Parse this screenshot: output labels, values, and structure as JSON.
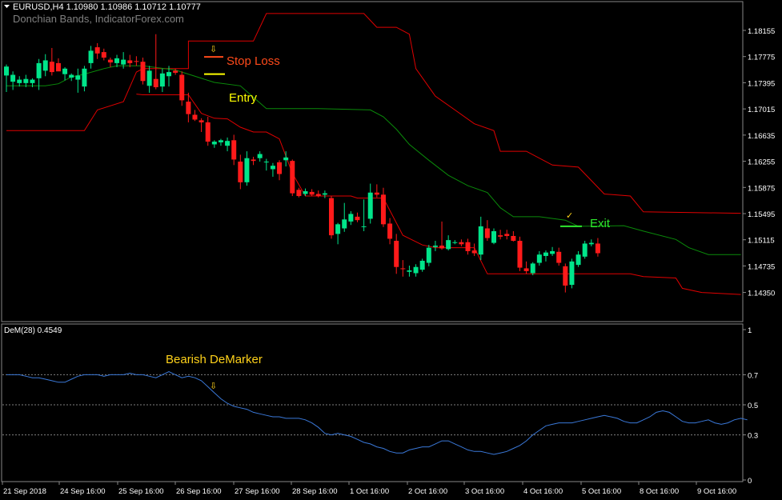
{
  "header": {
    "symbol_line": "EURUSD,H4  1.10980 1.10986 1.10712 1.10777",
    "indicator_name": "Donchian Bands, IndicatorForex.com"
  },
  "annotations": {
    "stop_loss": "Stop Loss",
    "entry": "Entry",
    "exit": "Exit",
    "bearish_demarker": "Bearish DeMarker",
    "down_arrow": "⇩",
    "check": "✓"
  },
  "subwindow": {
    "label": "DeM(28) 0.4549"
  },
  "colors": {
    "background": "#000000",
    "bull": "#00e58a",
    "bear": "#ff1a1a",
    "upper_band": "#e00000",
    "lower_band": "#e00000",
    "middle_band": "#0a8a0a",
    "demarker_line": "#3a78d8",
    "stop_loss": "#ff4a1a",
    "entry": "#ffff00",
    "exit": "#2ee82e",
    "bearish_text": "#ffd21a",
    "arrow": "#ffd21a",
    "grid": "#808080",
    "axis_text": "#ffffff"
  },
  "chart_data": [
    {
      "type": "candlestick",
      "title": "EURUSD,H4",
      "ylim": [
        1.1395,
        1.1855
      ],
      "price_labels": [
        "1.18155",
        "1.17775",
        "1.17395",
        "1.17015",
        "1.16635",
        "1.16255",
        "1.15875",
        "1.15495",
        "1.15115",
        "1.14735",
        "1.14350"
      ],
      "x_labels": [
        "21 Sep 2018",
        "24 Sep 16:00",
        "25 Sep 16:00",
        "26 Sep 16:00",
        "27 Sep 16:00",
        "28 Sep 16:00",
        "1 Oct 16:00",
        "2 Oct 16:00",
        "3 Oct 16:00",
        "4 Oct 16:00",
        "5 Oct 16:00",
        "8 Oct 16:00",
        "9 Oct 16:00"
      ],
      "candles": [
        {
          "o": 1.175,
          "h": 1.1766,
          "l": 1.1726,
          "c": 1.1763
        },
        {
          "o": 1.1741,
          "h": 1.1756,
          "l": 1.1729,
          "c": 1.1751
        },
        {
          "o": 1.1739,
          "h": 1.1749,
          "l": 1.1734,
          "c": 1.1744
        },
        {
          "o": 1.1739,
          "h": 1.1751,
          "l": 1.1733,
          "c": 1.1745
        },
        {
          "o": 1.1739,
          "h": 1.1746,
          "l": 1.1733,
          "c": 1.1744
        },
        {
          "o": 1.1746,
          "h": 1.1774,
          "l": 1.1729,
          "c": 1.1768
        },
        {
          "o": 1.1757,
          "h": 1.1781,
          "l": 1.1749,
          "c": 1.1772
        },
        {
          "o": 1.177,
          "h": 1.179,
          "l": 1.175,
          "c": 1.1755
        },
        {
          "o": 1.1768,
          "h": 1.1775,
          "l": 1.1758,
          "c": 1.1756
        },
        {
          "o": 1.1752,
          "h": 1.1762,
          "l": 1.1743,
          "c": 1.176
        },
        {
          "o": 1.1747,
          "h": 1.1753,
          "l": 1.1742,
          "c": 1.1751
        },
        {
          "o": 1.1744,
          "h": 1.176,
          "l": 1.1725,
          "c": 1.175
        },
        {
          "o": 1.1734,
          "h": 1.1764,
          "l": 1.1727,
          "c": 1.176
        },
        {
          "o": 1.1768,
          "h": 1.1793,
          "l": 1.176,
          "c": 1.1786
        },
        {
          "o": 1.1791,
          "h": 1.1797,
          "l": 1.1774,
          "c": 1.1782
        },
        {
          "o": 1.1784,
          "h": 1.1789,
          "l": 1.1772,
          "c": 1.1776
        },
        {
          "o": 1.1773,
          "h": 1.1776,
          "l": 1.1762,
          "c": 1.1769
        },
        {
          "o": 1.1768,
          "h": 1.178,
          "l": 1.1762,
          "c": 1.1775
        },
        {
          "o": 1.1766,
          "h": 1.1784,
          "l": 1.176,
          "c": 1.1773
        },
        {
          "o": 1.1772,
          "h": 1.178,
          "l": 1.1762,
          "c": 1.1768
        },
        {
          "o": 1.1771,
          "h": 1.1778,
          "l": 1.1764,
          "c": 1.177
        },
        {
          "o": 1.177,
          "h": 1.1776,
          "l": 1.1737,
          "c": 1.1742
        },
        {
          "o": 1.1735,
          "h": 1.1764,
          "l": 1.1725,
          "c": 1.1757
        },
        {
          "o": 1.1745,
          "h": 1.181,
          "l": 1.173,
          "c": 1.1733
        },
        {
          "o": 1.1734,
          "h": 1.176,
          "l": 1.1726,
          "c": 1.1753
        },
        {
          "o": 1.1749,
          "h": 1.1764,
          "l": 1.1734,
          "c": 1.1755
        },
        {
          "o": 1.1757,
          "h": 1.176,
          "l": 1.1751,
          "c": 1.1754
        },
        {
          "o": 1.1751,
          "h": 1.1756,
          "l": 1.1706,
          "c": 1.1714
        },
        {
          "o": 1.1712,
          "h": 1.1725,
          "l": 1.1682,
          "c": 1.1694
        },
        {
          "o": 1.1693,
          "h": 1.17,
          "l": 1.1684,
          "c": 1.1686
        },
        {
          "o": 1.1685,
          "h": 1.1688,
          "l": 1.1668,
          "c": 1.1682
        },
        {
          "o": 1.1682,
          "h": 1.169,
          "l": 1.1648,
          "c": 1.1654
        },
        {
          "o": 1.165,
          "h": 1.1656,
          "l": 1.1645,
          "c": 1.1654
        },
        {
          "o": 1.1653,
          "h": 1.1658,
          "l": 1.1648,
          "c": 1.1656
        },
        {
          "o": 1.1648,
          "h": 1.166,
          "l": 1.164,
          "c": 1.1655
        },
        {
          "o": 1.1656,
          "h": 1.1664,
          "l": 1.162,
          "c": 1.1628
        },
        {
          "o": 1.1625,
          "h": 1.1635,
          "l": 1.1585,
          "c": 1.1595
        },
        {
          "o": 1.1595,
          "h": 1.164,
          "l": 1.159,
          "c": 1.163
        },
        {
          "o": 1.1628,
          "h": 1.1632,
          "l": 1.162,
          "c": 1.1626
        },
        {
          "o": 1.163,
          "h": 1.164,
          "l": 1.1625,
          "c": 1.1636
        },
        {
          "o": 1.1624,
          "h": 1.1629,
          "l": 1.1612,
          "c": 1.1625
        },
        {
          "o": 1.1614,
          "h": 1.1623,
          "l": 1.1603,
          "c": 1.1619
        },
        {
          "o": 1.1624,
          "h": 1.1627,
          "l": 1.1598,
          "c": 1.1607
        },
        {
          "o": 1.1627,
          "h": 1.164,
          "l": 1.1618,
          "c": 1.1631
        },
        {
          "o": 1.1626,
          "h": 1.1628,
          "l": 1.1575,
          "c": 1.1579
        },
        {
          "o": 1.1584,
          "h": 1.1587,
          "l": 1.1573,
          "c": 1.1575
        },
        {
          "o": 1.1578,
          "h": 1.1586,
          "l": 1.1575,
          "c": 1.1582
        },
        {
          "o": 1.1581,
          "h": 1.1585,
          "l": 1.1575,
          "c": 1.1577
        },
        {
          "o": 1.1578,
          "h": 1.1583,
          "l": 1.1573,
          "c": 1.1575
        },
        {
          "o": 1.1577,
          "h": 1.1583,
          "l": 1.1572,
          "c": 1.1579
        },
        {
          "o": 1.1572,
          "h": 1.1575,
          "l": 1.1513,
          "c": 1.1518
        },
        {
          "o": 1.152,
          "h": 1.1536,
          "l": 1.1505,
          "c": 1.1534
        },
        {
          "o": 1.1528,
          "h": 1.1565,
          "l": 1.1523,
          "c": 1.1541
        },
        {
          "o": 1.1538,
          "h": 1.1553,
          "l": 1.1533,
          "c": 1.1549
        },
        {
          "o": 1.1545,
          "h": 1.1551,
          "l": 1.1537,
          "c": 1.154
        },
        {
          "o": 1.153,
          "h": 1.157,
          "l": 1.1524,
          "c": 1.1531
        },
        {
          "o": 1.1542,
          "h": 1.1593,
          "l": 1.1535,
          "c": 1.158
        },
        {
          "o": 1.158,
          "h": 1.1592,
          "l": 1.1573,
          "c": 1.1577
        },
        {
          "o": 1.1577,
          "h": 1.1587,
          "l": 1.153,
          "c": 1.1534
        },
        {
          "o": 1.1535,
          "h": 1.1543,
          "l": 1.1505,
          "c": 1.1513
        },
        {
          "o": 1.151,
          "h": 1.152,
          "l": 1.1462,
          "c": 1.1472
        },
        {
          "o": 1.147,
          "h": 1.1482,
          "l": 1.1458,
          "c": 1.1469
        },
        {
          "o": 1.1465,
          "h": 1.1474,
          "l": 1.1458,
          "c": 1.1467
        },
        {
          "o": 1.1463,
          "h": 1.1476,
          "l": 1.1458,
          "c": 1.1472
        },
        {
          "o": 1.1468,
          "h": 1.1484,
          "l": 1.1465,
          "c": 1.1481
        },
        {
          "o": 1.1478,
          "h": 1.1504,
          "l": 1.1473,
          "c": 1.15
        },
        {
          "o": 1.1501,
          "h": 1.151,
          "l": 1.1495,
          "c": 1.1503
        },
        {
          "o": 1.1503,
          "h": 1.1538,
          "l": 1.1497,
          "c": 1.1499
        },
        {
          "o": 1.1498,
          "h": 1.1518,
          "l": 1.1496,
          "c": 1.1511
        },
        {
          "o": 1.1507,
          "h": 1.1511,
          "l": 1.1505,
          "c": 1.1508
        },
        {
          "o": 1.1508,
          "h": 1.1512,
          "l": 1.1502,
          "c": 1.1505
        },
        {
          "o": 1.1508,
          "h": 1.1513,
          "l": 1.149,
          "c": 1.1495
        },
        {
          "o": 1.1496,
          "h": 1.1506,
          "l": 1.1488,
          "c": 1.1492
        },
        {
          "o": 1.149,
          "h": 1.1545,
          "l": 1.1482,
          "c": 1.1531
        },
        {
          "o": 1.1528,
          "h": 1.154,
          "l": 1.151,
          "c": 1.1514
        },
        {
          "o": 1.1507,
          "h": 1.1528,
          "l": 1.1505,
          "c": 1.1524
        },
        {
          "o": 1.1518,
          "h": 1.1526,
          "l": 1.1512,
          "c": 1.1516
        },
        {
          "o": 1.152,
          "h": 1.1526,
          "l": 1.1512,
          "c": 1.1517
        },
        {
          "o": 1.1517,
          "h": 1.1524,
          "l": 1.1509,
          "c": 1.151
        },
        {
          "o": 1.151,
          "h": 1.1516,
          "l": 1.1466,
          "c": 1.1471
        },
        {
          "o": 1.147,
          "h": 1.148,
          "l": 1.1462,
          "c": 1.1466
        },
        {
          "o": 1.1463,
          "h": 1.1479,
          "l": 1.146,
          "c": 1.1477
        },
        {
          "o": 1.1478,
          "h": 1.1495,
          "l": 1.1474,
          "c": 1.149
        },
        {
          "o": 1.1488,
          "h": 1.1496,
          "l": 1.148,
          "c": 1.1493
        },
        {
          "o": 1.1491,
          "h": 1.1501,
          "l": 1.1488,
          "c": 1.1495
        },
        {
          "o": 1.1494,
          "h": 1.15,
          "l": 1.1474,
          "c": 1.1478
        },
        {
          "o": 1.1473,
          "h": 1.1477,
          "l": 1.1435,
          "c": 1.1445
        },
        {
          "o": 1.1446,
          "h": 1.1484,
          "l": 1.1441,
          "c": 1.148
        },
        {
          "o": 1.1475,
          "h": 1.1495,
          "l": 1.1472,
          "c": 1.149
        },
        {
          "o": 1.1487,
          "h": 1.151,
          "l": 1.1484,
          "c": 1.1506
        },
        {
          "o": 1.1505,
          "h": 1.1512,
          "l": 1.1502,
          "c": 1.1507
        },
        {
          "o": 1.1506,
          "h": 1.1514,
          "l": 1.1487,
          "c": 1.1492
        }
      ],
      "bands": {
        "upper": [
          [
            0,
            1.167
          ],
          [
            12,
            1.167
          ],
          [
            14,
            1.17
          ],
          [
            18,
            1.1712
          ],
          [
            20,
            1.1755
          ],
          [
            21,
            1.176
          ],
          [
            28,
            1.176
          ],
          [
            28,
            1.18
          ],
          [
            38,
            1.18
          ],
          [
            40,
            1.184
          ],
          [
            55,
            1.184
          ],
          [
            57,
            1.182
          ],
          [
            60,
            1.182
          ],
          [
            62,
            1.181
          ],
          [
            63,
            1.176
          ],
          [
            66,
            1.172
          ],
          [
            69,
            1.17
          ],
          [
            72,
            1.168
          ],
          [
            75,
            1.167
          ],
          [
            76,
            1.164
          ],
          [
            80,
            1.164
          ],
          [
            84,
            1.162
          ],
          [
            88,
            1.1617
          ],
          [
            92,
            1.1578
          ],
          [
            96,
            1.1575
          ],
          [
            98,
            1.1552
          ],
          [
            113,
            1.155
          ]
        ],
        "middle": [
          [
            0,
            1.1735
          ],
          [
            6,
            1.1735
          ],
          [
            8,
            1.1738
          ],
          [
            10,
            1.1748
          ],
          [
            12,
            1.1752
          ],
          [
            15,
            1.176
          ],
          [
            17,
            1.1764
          ],
          [
            21,
            1.1764
          ],
          [
            26,
            1.1758
          ],
          [
            32,
            1.174
          ],
          [
            36,
            1.1735
          ],
          [
            40,
            1.1702
          ],
          [
            48,
            1.1702
          ],
          [
            56,
            1.17
          ],
          [
            58,
            1.169
          ],
          [
            60,
            1.1672
          ],
          [
            62,
            1.165
          ],
          [
            65,
            1.1627
          ],
          [
            68,
            1.1605
          ],
          [
            71,
            1.159
          ],
          [
            74,
            1.158
          ],
          [
            76,
            1.1558
          ],
          [
            78,
            1.1545
          ],
          [
            82,
            1.1545
          ],
          [
            86,
            1.154
          ],
          [
            88,
            1.1531
          ],
          [
            95,
            1.1532
          ],
          [
            98,
            1.1524
          ],
          [
            103,
            1.1512
          ],
          [
            105,
            1.15
          ],
          [
            108,
            1.149
          ],
          [
            113,
            1.149
          ]
        ],
        "lower": [
          [
            20,
            1.1723
          ],
          [
            21,
            1.1722
          ],
          [
            28,
            1.1722
          ],
          [
            30,
            1.1695
          ],
          [
            32,
            1.1688
          ],
          [
            34,
            1.1687
          ],
          [
            36,
            1.1675
          ],
          [
            38,
            1.1668
          ],
          [
            40,
            1.1668
          ],
          [
            42,
            1.1658
          ],
          [
            44,
            1.1608
          ],
          [
            46,
            1.1575
          ],
          [
            53,
            1.1575
          ],
          [
            54,
            1.1572
          ],
          [
            58,
            1.1572
          ],
          [
            61,
            1.1518
          ],
          [
            64,
            1.1504
          ],
          [
            66,
            1.15
          ],
          [
            72,
            1.15
          ],
          [
            74,
            1.1462
          ],
          [
            82,
            1.1462
          ],
          [
            96,
            1.1462
          ],
          [
            98,
            1.1458
          ],
          [
            103,
            1.1456
          ],
          [
            104,
            1.1441
          ],
          [
            107,
            1.1435
          ],
          [
            113,
            1.1432
          ]
        ]
      }
    },
    {
      "type": "line",
      "title": "DeM(28) 0.4549",
      "ylim": [
        0,
        1
      ],
      "y_tick_labels": [
        "1",
        "0.7",
        "0.5",
        "0.3",
        "0"
      ],
      "levels": [
        0.7,
        0.5,
        0.3
      ],
      "series": [
        {
          "values": [
            0.7,
            0.7,
            0.7,
            0.69,
            0.68,
            0.68,
            0.67,
            0.66,
            0.65,
            0.65,
            0.67,
            0.69,
            0.7,
            0.7,
            0.7,
            0.69,
            0.7,
            0.7,
            0.7,
            0.71,
            0.7,
            0.7,
            0.69,
            0.68,
            0.7,
            0.72,
            0.7,
            0.68,
            0.69,
            0.68,
            0.66,
            0.62,
            0.58,
            0.54,
            0.51,
            0.49,
            0.48,
            0.47,
            0.45,
            0.44,
            0.43,
            0.42,
            0.42,
            0.41,
            0.41,
            0.41,
            0.4,
            0.38,
            0.35,
            0.31,
            0.3,
            0.31,
            0.3,
            0.29,
            0.27,
            0.25,
            0.24,
            0.22,
            0.21,
            0.19,
            0.18,
            0.18,
            0.2,
            0.21,
            0.22,
            0.22,
            0.24,
            0.26,
            0.26,
            0.24,
            0.22,
            0.2,
            0.19,
            0.19,
            0.18,
            0.17,
            0.18,
            0.19,
            0.21,
            0.23,
            0.26,
            0.3,
            0.33,
            0.36,
            0.37,
            0.38,
            0.38,
            0.38,
            0.39,
            0.4,
            0.41,
            0.42,
            0.43,
            0.42,
            0.41,
            0.39,
            0.38,
            0.38,
            0.4,
            0.42,
            0.45,
            0.46,
            0.45,
            0.42,
            0.39,
            0.38,
            0.38,
            0.39,
            0.4,
            0.38,
            0.37,
            0.38,
            0.4,
            0.41,
            0.4
          ]
        }
      ]
    }
  ]
}
